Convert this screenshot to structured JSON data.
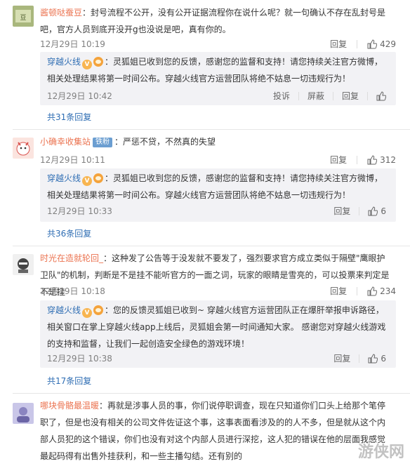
{
  "comments": [
    {
      "username": "酱顿哒蚕豆",
      "text": "：封号流程不公开，没有公开证据流程你在说什么呢？就一句确认不存在乱封号是吧，官方人员到底开没开g也没说是吧，真有你的。",
      "time": "12月29日 10:19",
      "reply_label": "回复",
      "likes": "429",
      "reply": {
        "username": "穿越火线",
        "text": "：灵狐姐已收到您的反馈，感谢您的监督和支持！请您持续关注官方微博，相关处理结果将第一时间公布。穿越火线官方运营团队将绝不姑息一切违规行为！",
        "time": "12月29日 10:42",
        "report_label": "投诉",
        "block_label": "屏蔽",
        "reply_label": "回复"
      },
      "more_replies": "共31条回复"
    },
    {
      "username": "小确幸收集站",
      "badge": "铁粉",
      "text": "：严惩不贷，不然真的失望",
      "time": "12月29日 10:11",
      "reply_label": "回复",
      "likes": "312",
      "reply": {
        "username": "穿越火线",
        "text": "：灵狐姐已收到您的反馈，感谢您的监督和支持！请您持续关注官方微博，相关处理结果将第一时间公布。穿越火线官方运营团队将绝不姑息一切违规行为！",
        "time": "12月29日 10:33",
        "reply_label": "回复",
        "likes": "6"
      },
      "more_replies": "共36条回复"
    },
    {
      "username": "时光在造就轮回_",
      "text": "：这种发了公告等于没发就不要发了，强烈要求官方成立类似于隔壁\"鹰眼护卫队\"的机制，判断是不是挂不能听官方的一面之词，玩家的眼睛是雪亮的，可以投票来判定是不是挂",
      "time": "12月29日 10:18",
      "reply_label": "回复",
      "likes": "234",
      "reply": {
        "username": "穿越火线",
        "text": "：您的反馈灵狐姐已收到~ 穿越火线官方运营团队正在爆肝举报申诉路径，相关窗口在掌上穿越火线app上线后，灵狐姐会第一时间通知大家。 感谢您对穿越火线游戏的支持和监督，让我们一起创造安全绿色的游戏环境！",
        "time": "12月29日 10:38",
        "reply_label": "回复",
        "likes": "6"
      },
      "more_replies": "共17条回复"
    },
    {
      "username": "哪块骨骼最温暖",
      "text": "：再就是涉事人员的事，你们说停职调查，现在只知道你们口头上给那个笔停职了，但是也没有相关的公司文件佐证这个事，这事表面看涉及的的人不多，但是就从这个内部人员犯的这个错误，你们也没有对这个内部人员进行深挖，这人犯的错误在他的层面我感觉最起码得有出售外挂获利，和一些主播勾结。还有别的"
    }
  ],
  "watermark": "游侠网",
  "colors": {
    "username": "#eb7350",
    "official": "#2e6db3",
    "reply_bg": "#f2f2f5",
    "link": "#2e6db3"
  }
}
